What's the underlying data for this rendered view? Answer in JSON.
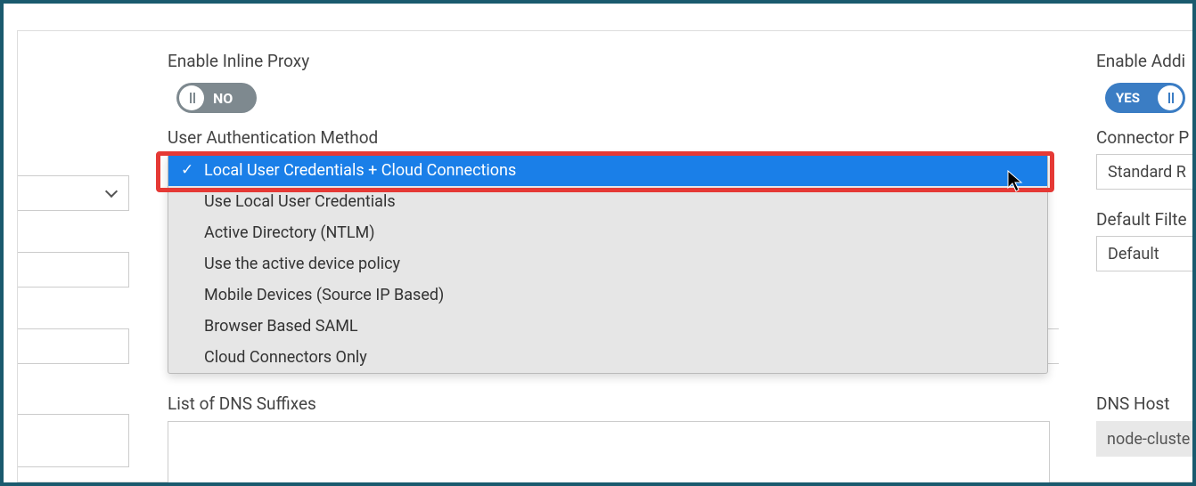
{
  "main": {
    "inline_proxy_label": "Enable Inline Proxy",
    "inline_proxy_value": "NO",
    "auth_method_label": "User Authentication Method",
    "auth_method_options": [
      "Local User Credentials + Cloud Connections",
      "Use Local User Credentials",
      "Active Directory (NTLM)",
      "Use the active device policy",
      "Mobile Devices (Source IP Based)",
      "Browser Based SAML",
      "Cloud Connectors Only"
    ],
    "auth_method_selected": "Local User Credentials + Cloud Connections",
    "dns_suffixes_label": "List of DNS Suffixes"
  },
  "right": {
    "enable_addi_label": "Enable Addi",
    "enable_addi_value": "YES",
    "connector_label": "Connector P",
    "connector_value": "Standard R",
    "default_filter_label": "Default Filte",
    "default_filter_value": "Default",
    "dns_host_label": "DNS Host",
    "dns_host_value": "node-cluste"
  }
}
